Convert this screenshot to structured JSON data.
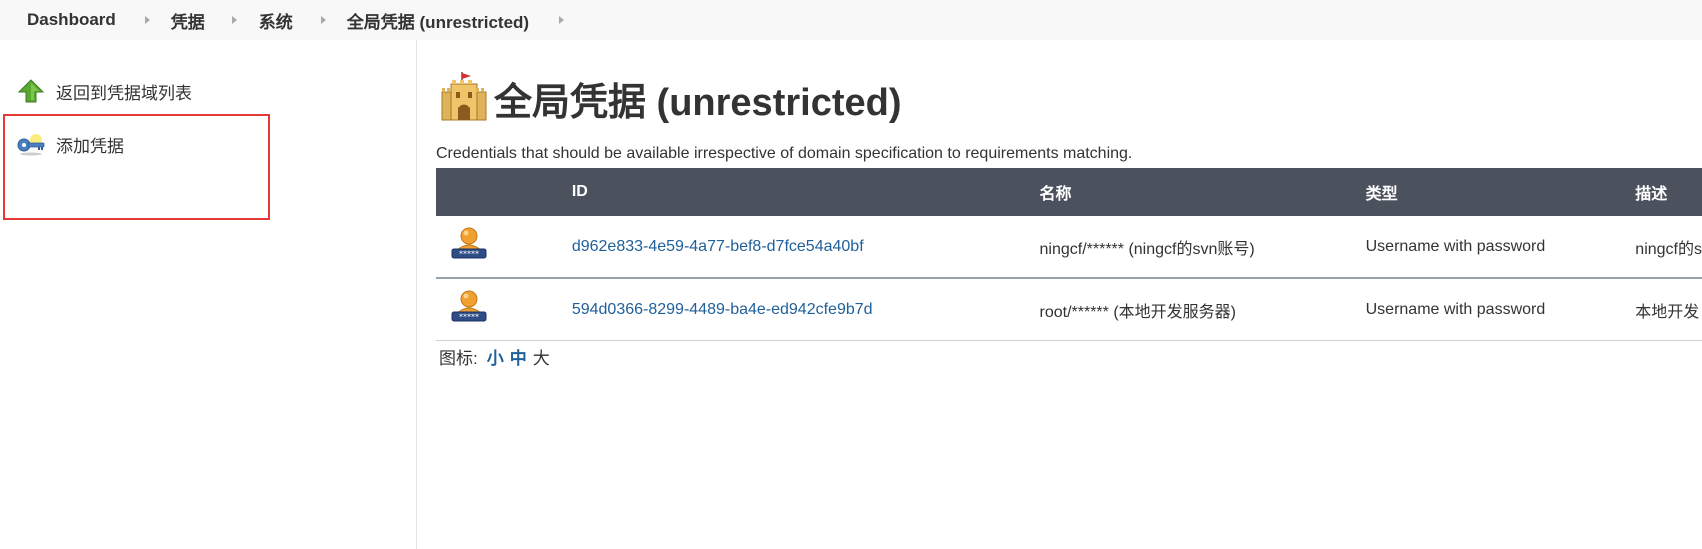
{
  "breadcrumb": {
    "items": [
      "Dashboard",
      "凭据",
      "系统",
      "全局凭据 (unrestricted)"
    ]
  },
  "sidebar": {
    "items": [
      {
        "label": "返回到凭据域列表",
        "icon": "up-arrow-icon"
      },
      {
        "label": "添加凭据",
        "icon": "key-icon"
      }
    ]
  },
  "main": {
    "title": "全局凭据 (unrestricted)",
    "title_icon": "castle-icon",
    "description": "Credentials that should be available irrespective of domain specification to requirements matching."
  },
  "table": {
    "headers": [
      "",
      "ID",
      "名称",
      "类型",
      "描述"
    ],
    "rows": [
      {
        "icon": "user-password-icon",
        "id": "d962e833-4e59-4a77-bef8-d7fce54a40bf",
        "name": "ningcf/****** (ningcf的svn账号)",
        "type": "Username with password",
        "description": "ningcf的s"
      },
      {
        "icon": "user-password-icon",
        "id": "594d0366-8299-4489-ba4e-ed942cfe9b7d",
        "name": "root/****** (本地开发服务器)",
        "type": "Username with password",
        "description": "本地开发"
      }
    ]
  },
  "icon_size": {
    "label": "图标:",
    "small": "小",
    "medium": "中",
    "large": "大"
  },
  "colors": {
    "header_bg": "#4b525e",
    "link": "#1f5f9a",
    "highlight": "#e53935"
  }
}
